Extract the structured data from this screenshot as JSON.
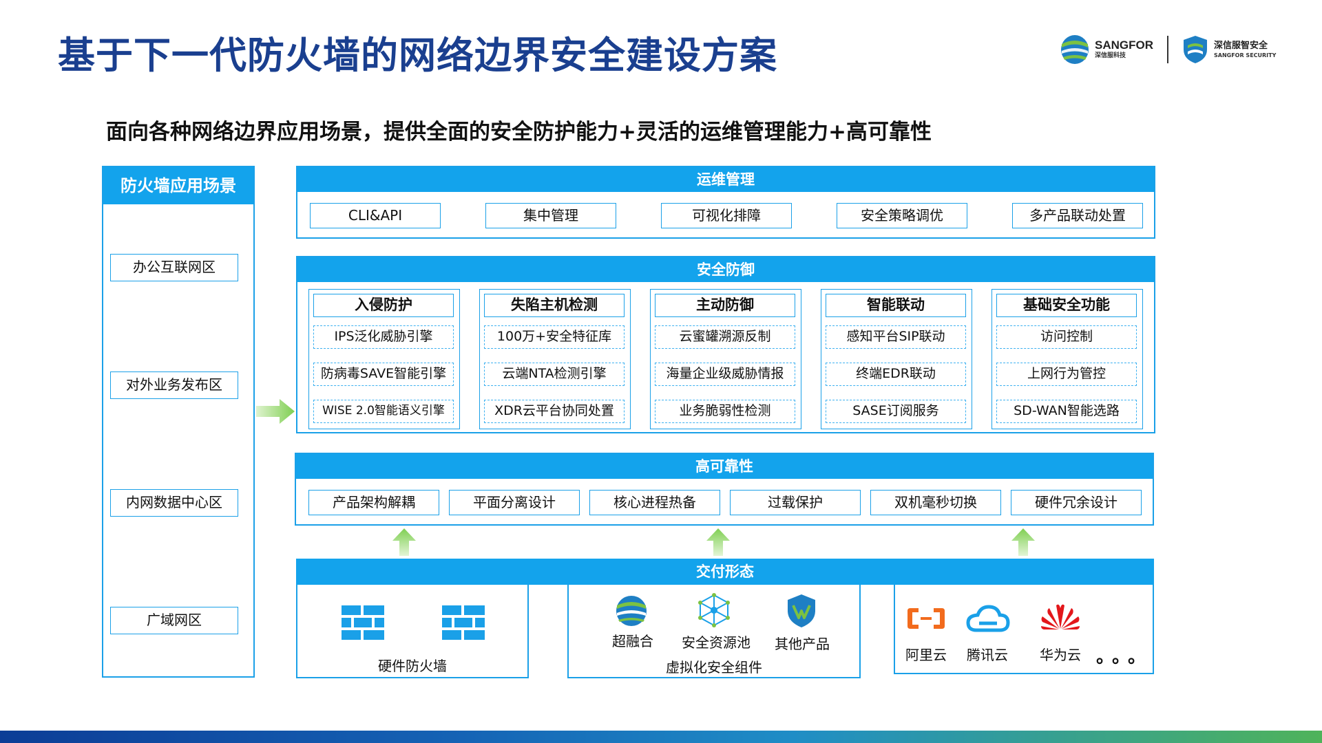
{
  "header": {
    "title": "基于下一代防火墙的网络边界安全建设方案",
    "subtitle": "面向各种网络边界应用场景，提供全面的安全防护能力+灵活的运维管理能力+高可靠性"
  },
  "logos": {
    "sangfor": {
      "main": "SANGFOR",
      "sub": "深信服科技"
    },
    "security": {
      "main": "深信服智安全",
      "sub": "SANGFOR SECURITY"
    }
  },
  "scenarios": {
    "title": "防火墙应用场景",
    "items": [
      "办公互联网区",
      "对外业务发布区",
      "内网数据中心区",
      "广域网区"
    ]
  },
  "ops": {
    "title": "运维管理",
    "items": [
      "CLI&API",
      "集中管理",
      "可视化排障",
      "安全策略调优",
      "多产品联动处置"
    ]
  },
  "defense": {
    "title": "安全防御",
    "groups": [
      {
        "title": "入侵防护",
        "items": [
          "IPS泛化威胁引擎",
          "防病毒SAVE智能引擎",
          "WISE 2.0智能语义引擎"
        ]
      },
      {
        "title": "失陷主机检测",
        "items": [
          "100万+安全特征库",
          "云端NTA检测引擎",
          "XDR云平台协同处置"
        ]
      },
      {
        "title": "主动防御",
        "items": [
          "云蜜罐溯源反制",
          "海量企业级威胁情报",
          "业务脆弱性检测"
        ]
      },
      {
        "title": "智能联动",
        "items": [
          "感知平台SIP联动",
          "终端EDR联动",
          "SASE订阅服务"
        ]
      },
      {
        "title": "基础安全功能",
        "items": [
          "访问控制",
          "上网行为管控",
          "SD-WAN智能选路"
        ]
      }
    ]
  },
  "reliability": {
    "title": "高可靠性",
    "items": [
      "产品架构解耦",
      "平面分离设计",
      "核心进程热备",
      "过载保护",
      "双机毫秒切换",
      "硬件冗余设计"
    ]
  },
  "delivery": {
    "title": "交付形态",
    "hardware_label": "硬件防火墙",
    "virtual": {
      "items": [
        "超融合",
        "安全资源池",
        "其他产品"
      ],
      "label": "虚拟化安全组件"
    },
    "cloud": {
      "items": [
        "阿里云",
        "腾讯云",
        "华为云"
      ],
      "more": "。。。"
    }
  },
  "colors": {
    "accent": "#13a3ec",
    "title": "#1a3f8f",
    "arrow": "#8fd46a"
  }
}
